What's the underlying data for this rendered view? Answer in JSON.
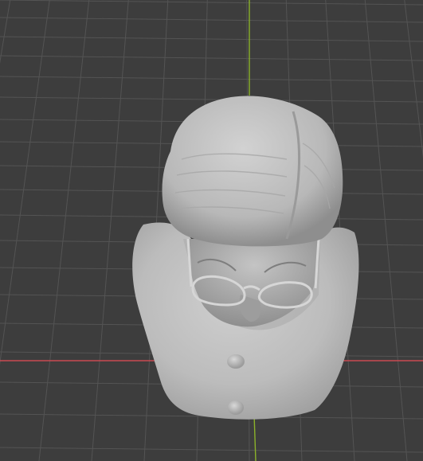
{
  "viewport": {
    "background_color": "#3d3d3d",
    "grid_color": "#545454",
    "x_axis_color": "#c94a52",
    "y_axis_color": "#8bb22a"
  },
  "object": {
    "kind": "sculpted bust",
    "material_color": "#bdbdbd",
    "features": [
      "hair",
      "glasses",
      "face",
      "shoulders",
      "buttons"
    ]
  }
}
